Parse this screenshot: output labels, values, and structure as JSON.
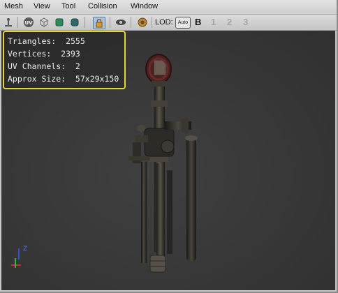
{
  "menu": {
    "items": [
      {
        "label": "Mesh"
      },
      {
        "label": "View"
      },
      {
        "label": "Tool"
      },
      {
        "label": "Collision"
      },
      {
        "label": "Window"
      }
    ]
  },
  "toolbar": {
    "uv_label": "UV",
    "lod_label": "LOD:",
    "lod_auto": "Auto",
    "lod_base": "B",
    "lod_levels": [
      "1",
      "2",
      "3"
    ]
  },
  "stats": {
    "triangles": "Triangles:  2555",
    "vertices": "Vertices:  2393",
    "uv_channels": "UV Channels:  2",
    "approx_size": "Approx Size:  57x29x150"
  },
  "axis": {
    "z_label": "Z"
  },
  "colors": {
    "highlight_border": "#e6d23a",
    "viewport_bg": "#383838"
  }
}
